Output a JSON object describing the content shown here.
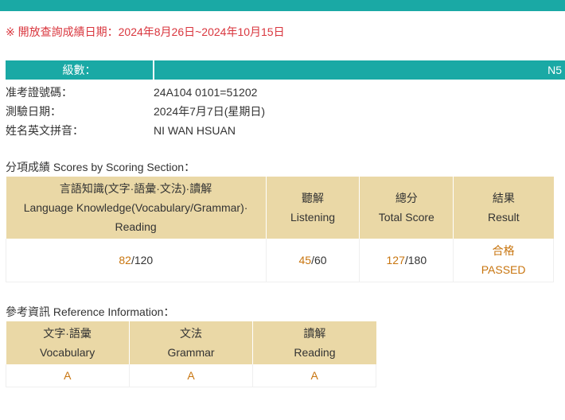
{
  "notice": "※ 開放查詢成績日期：2024年8月26日~2024年10月15日",
  "level": {
    "label": "級數：",
    "value": "N5"
  },
  "info": [
    {
      "key": "准考證號碼：",
      "value": "24A104 0101=51202"
    },
    {
      "key": "測驗日期：",
      "value": "2024年7月7日(星期日)"
    },
    {
      "key": "姓名英文拼音：",
      "value": "NI WAN HSUAN"
    }
  ],
  "scores": {
    "title": "分項成績 Scores by Scoring Section：",
    "headers": [
      {
        "zh": "言語知識(文字·語彙·文法)·讀解",
        "en": "Language Knowledge(Vocabulary/Grammar)·",
        "en2": "Reading"
      },
      {
        "zh": "聽解",
        "en": "Listening"
      },
      {
        "zh": "總分",
        "en": "Total Score"
      },
      {
        "zh": "結果",
        "en": "Result"
      }
    ],
    "row": {
      "language": {
        "score": "82",
        "max": "/120"
      },
      "listening": {
        "score": "45",
        "max": "/60"
      },
      "total": {
        "score": "127",
        "max": "/180"
      },
      "result": {
        "zh": "合格",
        "en": "PASSED"
      }
    }
  },
  "reference": {
    "title": "參考資訊 Reference Information：",
    "headers": [
      {
        "zh": "文字·語彙",
        "en": "Vocabulary"
      },
      {
        "zh": "文法",
        "en": "Grammar"
      },
      {
        "zh": "讀解",
        "en": "Reading"
      }
    ],
    "values": [
      "A",
      "A",
      "A"
    ]
  },
  "colors": {
    "teal": "#1aa9a5",
    "tan": "#ead8a6",
    "accent": "#c8750f",
    "notice": "#d9363e"
  }
}
